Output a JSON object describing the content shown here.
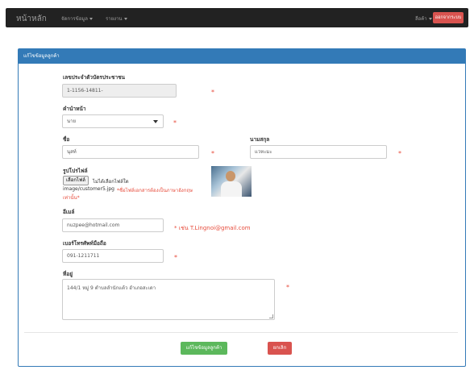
{
  "navbar": {
    "brand": "หน้าหลัก",
    "menu_manage": "จัดการข้อมูล",
    "menu_report": "รายงาน",
    "menu_customer": "ลือค้า",
    "logout_label": "ออกจากระบบ"
  },
  "panel": {
    "title": "แก้ไขข้อมูลลูกค้า"
  },
  "form": {
    "id_label": "เลขประจำตัวบัตรประชาชน",
    "id_value": "1-1156-14811-",
    "prefix_label": "คำนำหน้า",
    "prefix_value": "นาย",
    "firstname_label": "ชื่อ",
    "firstname_value": "นุสท์",
    "lastname_label": "นามสกุล",
    "lastname_value": "แวหะมะ",
    "photo_label": "รูปโปรไฟล์",
    "file_button": "เลือกไฟล์",
    "file_status": "ไม่ได้เลือกไฟล์ใด",
    "file_path": "image/customer5.jpg",
    "file_note_1": "*ชื่อไฟล์เอกสารต้องเป็นภาษาอังกฤษ",
    "file_note_2": "เท่านั้น*",
    "email_label": "อีเมล์",
    "email_value": "nuzpee@hotmail.com",
    "email_hint": "* เช่น  T.Lingnoi@gmail.com",
    "phone_label": "เบอร์โทรศัพท์มือถือ",
    "phone_value": "091-1211711",
    "address_label": "ที่อยู่",
    "address_value": "144/1  หมู่ 9  ตำบลลำนักแต้ว  อำเภอสะเดา",
    "required_mark": "*"
  },
  "actions": {
    "save_label": "แก้ไขข้อมูลลูกค้า",
    "cancel_label": "ยกเลิก"
  },
  "colors": {
    "primary": "#337ab7",
    "success": "#5cb85c",
    "danger": "#d9534f",
    "navbar": "#222222"
  }
}
